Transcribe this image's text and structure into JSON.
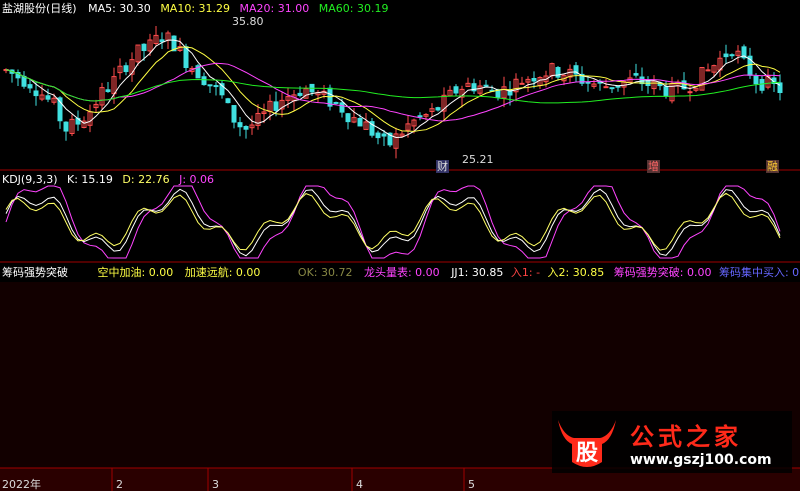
{
  "colors": {
    "up": "#ff4d4d",
    "down": "#40e0e0",
    "ma5": "#ffffff",
    "ma10": "#ffff44",
    "ma20": "#ff44ff",
    "ma60": "#22ee22",
    "k": "#ffffff",
    "d": "#ffff66",
    "j": "#ff44ff",
    "border": "#a00000",
    "bottomBg": "#2a0000"
  },
  "main_chart": {
    "title": "盐湖股份(日线)",
    "ma5": "MA5: 30.30",
    "ma10": "MA10: 31.29",
    "ma20": "MA20: 31.00",
    "ma60": "MA60: 30.19",
    "high_label": "35.80",
    "low_label": "25.21",
    "markers": [
      "财",
      "增",
      "融"
    ]
  },
  "kdj": {
    "title": "KDJ(9,3,3)",
    "k": "K: 15.19",
    "d": "D: 22.76",
    "j": "J: 0.06"
  },
  "indicator": {
    "title": "筹码强势突破",
    "item1": "空中加油: 0.00",
    "item2": "加速远航: 0.00",
    "ok": "OK: 30.72",
    "item3": "龙头量表: 0.00",
    "jj1": "JJ1: 30.85",
    "in1": "入1: -",
    "in2": "入2: 30.85",
    "item4": "筹码强势突破: 0.00",
    "item5": "筹码集中买入: 0.00"
  },
  "time_axis": {
    "labels": [
      "2022年",
      "2",
      "3",
      "4",
      "5"
    ]
  },
  "watermark": {
    "logo": "股",
    "brand": "公式之家",
    "url": "www.gszj100.com"
  }
}
